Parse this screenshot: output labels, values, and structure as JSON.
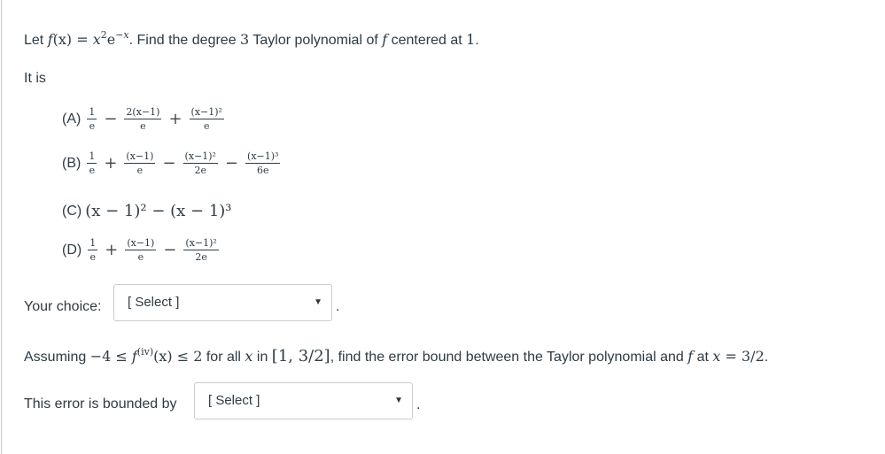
{
  "question": {
    "intro_prefix": "Let ",
    "function_def": {
      "lhs_f": "f",
      "lhs_x": "(x)",
      "eq": " = ",
      "base": "x",
      "exp": "2",
      "e": "e",
      "e_exp": "−x"
    },
    "intro_mid": ". Find the degree ",
    "degree": "3",
    "intro_mid2": " Taylor polynomial of ",
    "f_symbol": "f",
    "intro_mid3": " centered at ",
    "center": "1",
    "intro_end": "."
  },
  "it_is": "It is",
  "options": [
    {
      "label": "(A)",
      "terms": [
        {
          "type": "frac",
          "num": "1",
          "den": "e"
        },
        {
          "type": "op",
          "value": "−"
        },
        {
          "type": "frac",
          "num": "2(x−1)",
          "den": "e"
        },
        {
          "type": "op",
          "value": "+"
        },
        {
          "type": "frac",
          "num": "(x−1)²",
          "den": "e"
        }
      ]
    },
    {
      "label": "(B)",
      "terms": [
        {
          "type": "frac",
          "num": "1",
          "den": "e"
        },
        {
          "type": "op",
          "value": "+"
        },
        {
          "type": "frac",
          "num": "(x−1)",
          "den": "e"
        },
        {
          "type": "op",
          "value": "−"
        },
        {
          "type": "frac",
          "num": "(x−1)²",
          "den": "2e"
        },
        {
          "type": "op",
          "value": "−"
        },
        {
          "type": "frac",
          "num": "(x−1)³",
          "den": "6e"
        }
      ]
    },
    {
      "label": "(C)",
      "expression": "(x − 1)² − (x − 1)³"
    },
    {
      "label": "(D)",
      "terms": [
        {
          "type": "frac",
          "num": "1",
          "den": "e"
        },
        {
          "type": "op",
          "value": "+"
        },
        {
          "type": "frac",
          "num": "(x−1)",
          "den": "e"
        },
        {
          "type": "op",
          "value": "−"
        },
        {
          "type": "frac",
          "num": "(x−1)²",
          "den": "2e"
        }
      ]
    }
  ],
  "choice": {
    "label": "Your choice:",
    "select_value": "[ Select ]",
    "after": "."
  },
  "part2": {
    "prefix": "Assuming ",
    "lower": "−4",
    "le": " ≤ ",
    "f": "f",
    "deriv": "(iv)",
    "x": "(x)",
    "upper": "2",
    "mid": " for all ",
    "var": "x",
    "mid2": " in ",
    "interval": "[1, 3/2]",
    "mid3": ", find the error bound between the Taylor polynomial and ",
    "f2": "f",
    "mid4": " at ",
    "x_eq": "x",
    "eq": " = ",
    "value": "3/2",
    "end": "."
  },
  "error": {
    "label": "This error is bounded by",
    "select_value": "[ Select ]",
    "after": "."
  },
  "icons": {
    "caret": "▼"
  }
}
